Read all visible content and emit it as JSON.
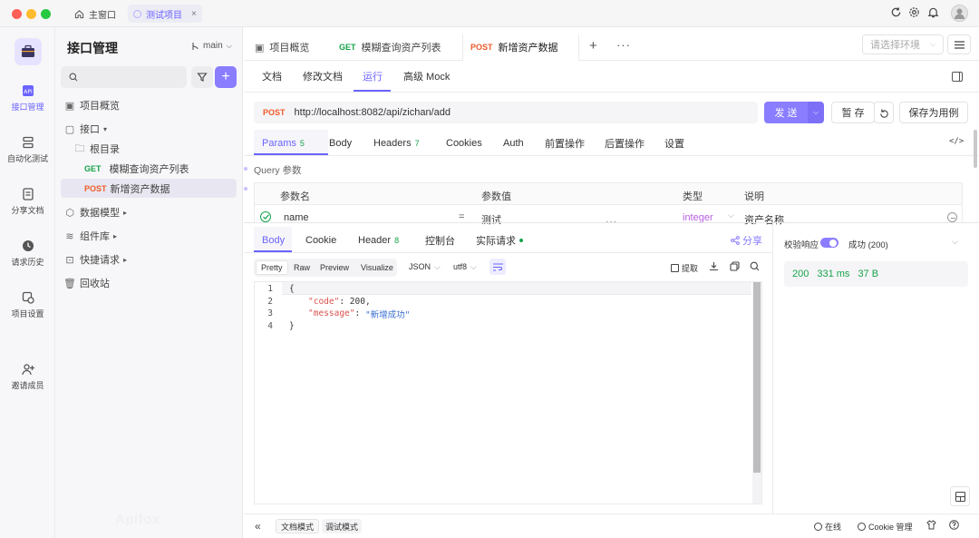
{
  "titlebar": {
    "tabs": [
      {
        "label": "主窗口"
      },
      {
        "label": "测试项目"
      }
    ]
  },
  "rail": {
    "items": [
      {
        "label": "接口管理",
        "icon": "api-icon"
      },
      {
        "label": "自动化测试",
        "icon": "automation-icon"
      },
      {
        "label": "分享文档",
        "icon": "share-doc-icon"
      },
      {
        "label": "请求历史",
        "icon": "history-icon"
      },
      {
        "label": "项目设置",
        "icon": "settings-icon"
      },
      {
        "label": "邀请成员",
        "icon": "invite-user-icon"
      }
    ]
  },
  "tree": {
    "title": "接口管理",
    "branch": "main",
    "items": [
      {
        "label": "项目概览"
      },
      {
        "label": "接口"
      },
      {
        "label": "根目录"
      },
      {
        "method": "GET",
        "label": "模糊查询资产列表"
      },
      {
        "method": "POST",
        "label": "新增资产数据"
      },
      {
        "label": "数据模型"
      },
      {
        "label": "组件库"
      },
      {
        "label": "快捷请求"
      },
      {
        "label": "回收站"
      }
    ],
    "watermark": "Apifox"
  },
  "tabs": {
    "items": [
      {
        "label": "项目概览"
      },
      {
        "method": "GET",
        "label": "模糊查询资产列表"
      },
      {
        "method": "POST",
        "label": "新增资产数据"
      }
    ],
    "env_placeholder": "请选择环境"
  },
  "subtabs": [
    "文档",
    "修改文档",
    "运行",
    "高级 Mock"
  ],
  "request": {
    "method": "POST",
    "url": "http://localhost:8082/api/zichan/add",
    "send_label": "发 送",
    "save_label": "暂 存",
    "save_case_label": "保存为用例"
  },
  "param_tabs": [
    {
      "label": "Params",
      "count": "5"
    },
    {
      "label": "Body",
      "count": ""
    },
    {
      "label": "Headers",
      "count": "7"
    },
    {
      "label": "Cookies",
      "count": ""
    },
    {
      "label": "Auth",
      "count": ""
    },
    {
      "label": "前置操作",
      "count": ""
    },
    {
      "label": "后置操作",
      "count": ""
    },
    {
      "label": "设置",
      "count": ""
    }
  ],
  "query": {
    "section_title": "Query 参数",
    "headers": [
      "参数名",
      "参数值",
      "类型",
      "说明"
    ],
    "rows": [
      {
        "name": "name",
        "op": "=",
        "value": "测试",
        "type": "integer",
        "desc": "资产名称"
      }
    ]
  },
  "response_tabs": [
    {
      "label": "Body",
      "count": ""
    },
    {
      "label": "Cookie",
      "count": ""
    },
    {
      "label": "Header",
      "count": "8"
    },
    {
      "label": "控制台",
      "count": ""
    },
    {
      "label": "实际请求",
      "count": ""
    }
  ],
  "share_label": "分享",
  "format_bar": {
    "buttons": [
      "Pretty",
      "Raw",
      "Preview",
      "Visualize"
    ],
    "format": "JSON",
    "encoding": "utf8",
    "extract_label": "提取"
  },
  "code_lines": [
    {
      "n": "1",
      "text": "{"
    },
    {
      "n": "2",
      "key": "\"code\"",
      "val": "200",
      "tail": ","
    },
    {
      "n": "3",
      "key": "\"message\"",
      "val": "\"新增成功\"",
      "tail": ""
    },
    {
      "n": "4",
      "text": "}"
    }
  ],
  "validate": {
    "label": "校验响应",
    "result": "成功 (200)",
    "status": "200",
    "time": "331 ms",
    "size": "37 B"
  },
  "footer": {
    "doc_mode": "文档模式",
    "debug_mode": "调试模式",
    "online": "在线",
    "cookie": "Cookie 管理"
  },
  "colors": {
    "accent": "#6b63ff",
    "get": "#17a34a",
    "post": "#f05a28"
  }
}
